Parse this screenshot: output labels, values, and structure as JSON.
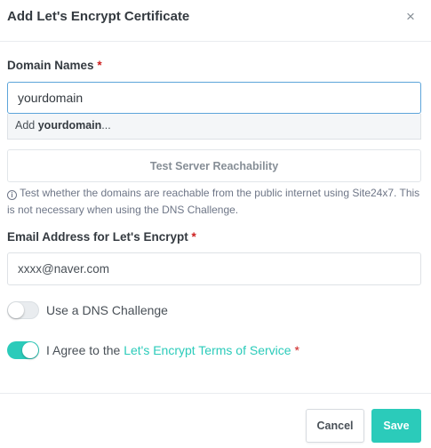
{
  "modal": {
    "title": "Add Let's Encrypt Certificate",
    "close_symbol": "×"
  },
  "domain_names": {
    "label": "Domain Names",
    "required_mark": "*",
    "value": "yourdomain",
    "suggestion_prefix": "Add",
    "suggestion_value": "yourdomain",
    "suggestion_suffix": "..."
  },
  "test_button": {
    "label": "Test Server Reachability"
  },
  "hint": {
    "icon": "info-icon",
    "text": "Test whether the domains are reachable from the public internet using Site24x7. This is not necessary when using the DNS Challenge."
  },
  "email": {
    "label": "Email Address for Let's Encrypt",
    "required_mark": "*",
    "value": "xxxx@naver.com"
  },
  "dns_challenge": {
    "label": "Use a DNS Challenge",
    "checked": false
  },
  "agree_tos": {
    "prefix": "I Agree to the",
    "link_text": "Let's Encrypt Terms of Service",
    "required_mark": "*",
    "checked": true
  },
  "footer": {
    "cancel_label": "Cancel",
    "save_label": "Save"
  },
  "colors": {
    "accent": "#2bcbba",
    "required": "#cd201f",
    "focus_border": "#5da5da"
  }
}
